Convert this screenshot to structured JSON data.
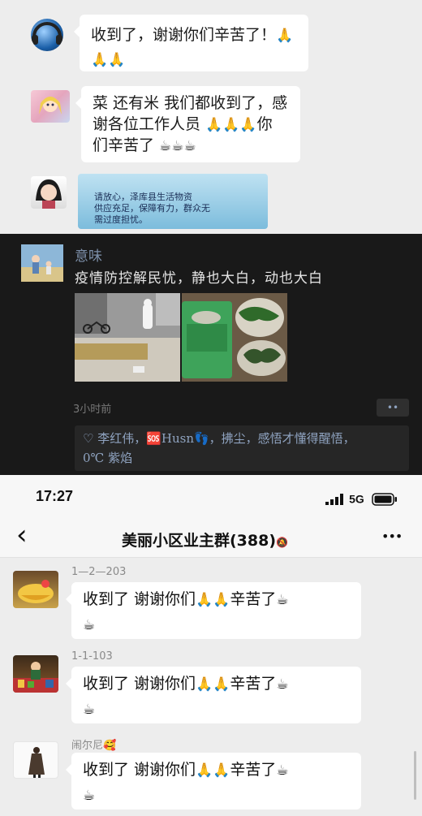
{
  "chat1": {
    "messages": [
      {
        "avatar": "headphone-globe-avatar",
        "lines": [
          "收到了，谢谢你们辛苦了！",
          ""
        ],
        "emoji_end_line1": "🙏",
        "emoji_line2": "🙏🙏"
      },
      {
        "avatar": "cartoon-girl-avatar",
        "line1": "菜 还有米 我们都收到了，感",
        "line2_text": "谢各位工作人员 ",
        "line2_emoji": "🙏🙏🙏",
        "line2_tail": "你",
        "line3_text": "们辛苦了 ",
        "line3_emoji": "☕☕☕"
      },
      {
        "avatar": "child-photo-avatar",
        "poster_text": [
          "请放心，泽库县生活物资",
          "供应充足，保障有力，群众无",
          "需过度担忧。"
        ]
      }
    ]
  },
  "moment": {
    "name": "意味",
    "text": "疫情防控解民忧，静也大白，动也大白",
    "time": "3小时前",
    "more": "••",
    "likes_line1": "♡ 李红伟，🆘Husn👣，拂尘，感悟才懂得醒悟，",
    "likes_line2": "0℃  紫焰"
  },
  "phone": {
    "status_time": "17:27",
    "network": "5G",
    "title": "美丽小区业主群(388)",
    "mute_icon": "🔕",
    "back": "‹",
    "more": "•••",
    "messages": [
      {
        "sender": "1—2—203",
        "text": "收到了  谢谢你们",
        "emoji": "🙏🙏",
        "tail": "辛苦了",
        "cup": "☕",
        "cup2": "☕"
      },
      {
        "sender": "1-1-103",
        "text": "收到了  谢谢你们",
        "emoji": "🙏🙏",
        "tail": "辛苦了",
        "cup": "☕",
        "cup2": "☕"
      },
      {
        "sender": "闹尔尼🥰",
        "text": "收到了  谢谢你们",
        "emoji": "🙏🙏",
        "tail": "辛苦了",
        "cup": "☕",
        "cup2": "☕"
      }
    ]
  },
  "colors": {
    "chat_bg": "#ededed",
    "moment_bg": "#191919",
    "link_blue": "#7d90aa",
    "bubble": "#ffffff"
  }
}
